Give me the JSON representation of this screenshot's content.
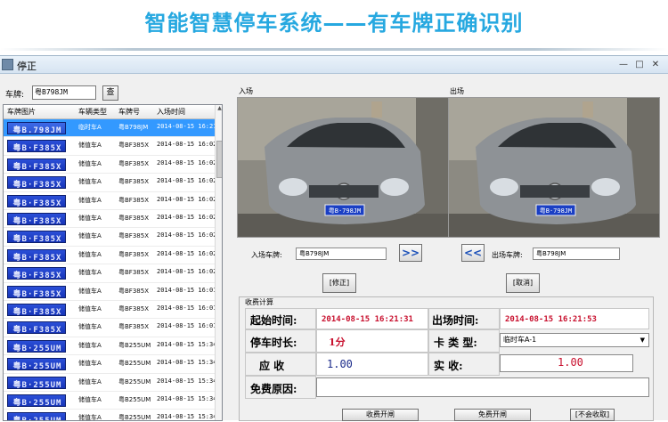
{
  "banner": {
    "title": "智能智慧停车系统——有车牌正确识别"
  },
  "window": {
    "title": "停正",
    "minimize": "—",
    "maximize": "□",
    "close": "✕"
  },
  "search": {
    "label": "车牌:",
    "value": "粤B798JM",
    "button": "查"
  },
  "grid": {
    "headers": [
      "车牌图片",
      "车辆类型",
      "车牌号",
      "入场时间"
    ],
    "rows": [
      {
        "plate_img": "粤B.798JM",
        "type": "临时车A",
        "plate": "粤B798JM",
        "time": "2014-08-15 16:21",
        "selected": true
      },
      {
        "plate_img": "粤B·F385X",
        "type": "储值车A",
        "plate": "粤BF385X",
        "time": "2014-08-15 16:02"
      },
      {
        "plate_img": "粤B·F385X",
        "type": "储值车A",
        "plate": "粤BF385X",
        "time": "2014-08-15 16:02"
      },
      {
        "plate_img": "粤B·F385X",
        "type": "储值车A",
        "plate": "粤BF385X",
        "time": "2014-08-15 16:02"
      },
      {
        "plate_img": "粤B·F385X",
        "type": "储值车A",
        "plate": "粤BF385X",
        "time": "2014-08-15 16:02"
      },
      {
        "plate_img": "粤B·F385X",
        "type": "储值车A",
        "plate": "粤BF385X",
        "time": "2014-08-15 16:02"
      },
      {
        "plate_img": "粤B·F385X",
        "type": "储值车A",
        "plate": "粤BF385X",
        "time": "2014-08-15 16:02"
      },
      {
        "plate_img": "粤B·F385X",
        "type": "储值车A",
        "plate": "粤BF385X",
        "time": "2014-08-15 16:02"
      },
      {
        "plate_img": "粤B·F385X",
        "type": "储值车A",
        "plate": "粤BF385X",
        "time": "2014-08-15 16:02"
      },
      {
        "plate_img": "粤B·F385X",
        "type": "储值车A",
        "plate": "粤BF385X",
        "time": "2014-08-15 16:01"
      },
      {
        "plate_img": "粤B·F385X",
        "type": "储值车A",
        "plate": "粤BF385X",
        "time": "2014-08-15 16:01"
      },
      {
        "plate_img": "粤B·F385X",
        "type": "储值车A",
        "plate": "粤BF385X",
        "time": "2014-08-15 16:01"
      },
      {
        "plate_img": "粤B·255UM",
        "type": "储值车A",
        "plate": "粤B255UM",
        "time": "2014-08-15 15:34"
      },
      {
        "plate_img": "粤B·255UM",
        "type": "储值车A",
        "plate": "粤B255UM",
        "time": "2014-08-15 15:34"
      },
      {
        "plate_img": "粤B·255UM",
        "type": "储值车A",
        "plate": "粤B255UM",
        "time": "2014-08-15 15:34"
      },
      {
        "plate_img": "粤B·255UM",
        "type": "储值车A",
        "plate": "粤B255UM",
        "time": "2014-08-15 15:34"
      },
      {
        "plate_img": "粤B·255UM",
        "type": "储值车A",
        "plate": "粤B255UM",
        "time": "2014-08-15 15:34"
      }
    ]
  },
  "entry": {
    "label": "入场",
    "plate_label": "入场车牌:",
    "plate_value": "粤B798JM",
    "arrow": ">>",
    "fix_button": "[修正]"
  },
  "exit": {
    "label": "出场",
    "plate_label": "出场车牌:",
    "plate_value": "粤B798JM",
    "arrow": "<<",
    "cancel_button": "[取消]"
  },
  "photo": {
    "car_plate": "粤B·798JM"
  },
  "fee": {
    "group_title": "收费计算",
    "start_label": "起始时间:",
    "start_value": "2014-08-15  16:21:31",
    "exit_label": "出场时间:",
    "exit_value": "2014-08-15  16:21:53",
    "duration_label": "停车时长:",
    "duration_value": "1分",
    "card_label": "卡  类  型:",
    "card_value": "临时车A-1",
    "due_label": "应    收",
    "due_value": "1.00",
    "paid_label": "实      收:",
    "paid_value": "1.00",
    "reason_label": "免费原因:",
    "reason_value": ""
  },
  "bottom": {
    "btn1": "收费开闸",
    "btn2": "免费开闸",
    "btn3": "[不会收取]"
  },
  "colors": {
    "banner": "#26a8e0",
    "plate_blue": "#1735b8",
    "red_value": "#c8102e",
    "selection": "#3399ff"
  }
}
